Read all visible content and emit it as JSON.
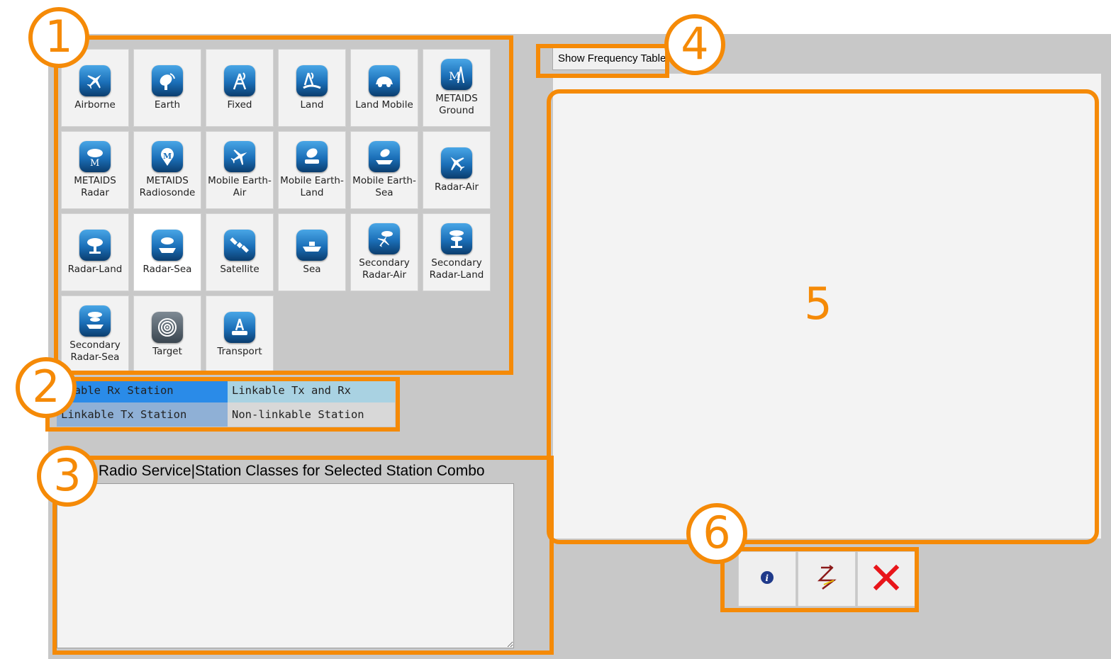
{
  "stations": [
    {
      "label": "Airborne",
      "icon": "airplane-icon"
    },
    {
      "label": "Earth",
      "icon": "satellite-dish-icon"
    },
    {
      "label": "Fixed",
      "icon": "antenna-tower-icon"
    },
    {
      "label": "Land",
      "icon": "land-antenna-icon"
    },
    {
      "label": "Land Mobile",
      "icon": "car-icon"
    },
    {
      "label": "METAIDS Ground",
      "icon": "metaids-tower-icon"
    },
    {
      "label": "METAIDS Radar",
      "icon": "metaids-radar-icon"
    },
    {
      "label": "METAIDS Radiosonde",
      "icon": "radiosonde-balloon-icon"
    },
    {
      "label": "Mobile Earth-Air",
      "icon": "plane-dish-icon"
    },
    {
      "label": "Mobile Earth-Land",
      "icon": "vehicle-dish-icon"
    },
    {
      "label": "Mobile Earth-Sea",
      "icon": "ship-dish-icon"
    },
    {
      "label": "Radar-Air",
      "icon": "radar-plane-icon"
    },
    {
      "label": "Radar-Land",
      "icon": "radar-land-icon"
    },
    {
      "label": "Radar-Sea",
      "icon": "radar-ship-icon"
    },
    {
      "label": "Satellite",
      "icon": "satellite-icon"
    },
    {
      "label": "Sea",
      "icon": "ship-icon"
    },
    {
      "label": "Secondary Radar-Air",
      "icon": "secondary-radar-air-icon"
    },
    {
      "label": "Secondary Radar-Land",
      "icon": "secondary-radar-land-icon"
    },
    {
      "label": "Secondary Radar-Sea",
      "icon": "secondary-radar-sea-icon"
    },
    {
      "label": "Target",
      "icon": "target-icon"
    },
    {
      "label": "Transport",
      "icon": "transport-icon"
    }
  ],
  "selected_station": "Radar-Sea",
  "legend": {
    "rx": {
      "label": "nkable Rx Station",
      "color": "#2a8be8"
    },
    "txrx": {
      "label": "Linkable Tx and Rx",
      "color": "#a9d2e2"
    },
    "tx": {
      "label": "Linkable Tx Station",
      "color": "#8fb0d6"
    },
    "none": {
      "label": "Non-linkable Station",
      "color": "#d8d8d8"
    }
  },
  "combo_title": "ble Radio Service|Station Classes for Selected Station Combo",
  "freq_button": "Show Frequency Table",
  "actions": [
    {
      "name": "info-button",
      "icon": "info-icon"
    },
    {
      "name": "link-button",
      "icon": "lightning-link-icon"
    },
    {
      "name": "delete-button",
      "icon": "close-x-icon"
    }
  ],
  "annotations": [
    "1",
    "2",
    "3",
    "4",
    "5",
    "6"
  ],
  "colors": {
    "annotation": "#f58a07",
    "background": "#c8c8c8",
    "panel": "#f3f3f3"
  }
}
